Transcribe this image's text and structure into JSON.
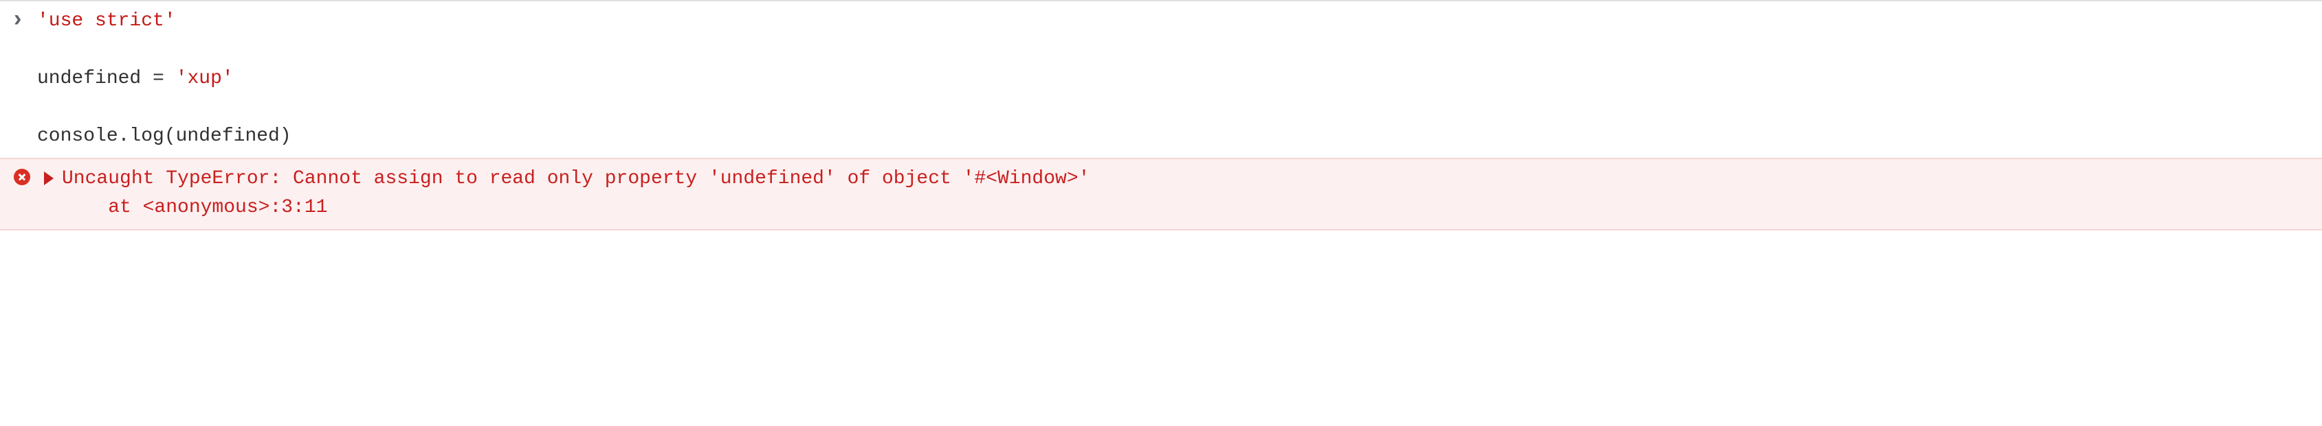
{
  "console": {
    "input": {
      "line1_str": "'use strict'",
      "blank1": "",
      "line2_lhs": "undefined ",
      "line2_eq": "=",
      "line2_sp": " ",
      "line2_rhs": "'xup'",
      "blank2": "",
      "line3": "console.log(undefined)"
    },
    "error": {
      "message": "Uncaught TypeError: Cannot assign to read only property 'undefined' of object '#<Window>'",
      "stack": "    at <anonymous>:3:11"
    }
  }
}
